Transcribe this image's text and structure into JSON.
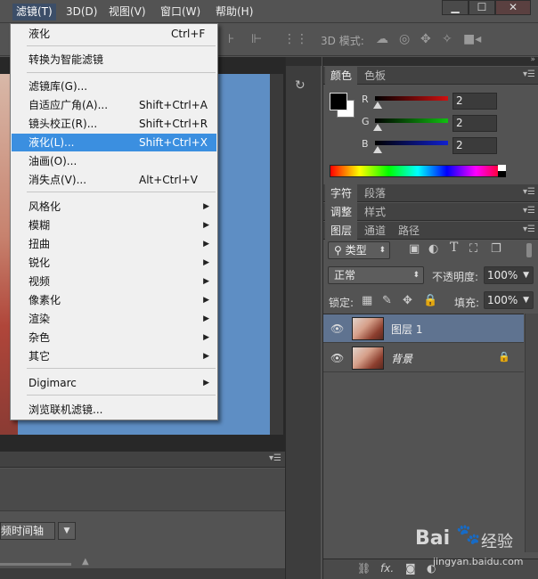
{
  "menubar": {
    "items": [
      {
        "label": "滤镜(T)"
      },
      {
        "label": "3D(D)"
      },
      {
        "label": "视图(V)"
      },
      {
        "label": "窗口(W)"
      },
      {
        "label": "帮助(H)"
      }
    ],
    "window_controls": [
      "▁",
      "☐",
      "✕"
    ]
  },
  "options_bar": {
    "mode_label": "3D 模式:"
  },
  "filter_menu": {
    "items": [
      {
        "label": "液化",
        "shortcut": "Ctrl+F"
      },
      {
        "label": "转换为智能滤镜",
        "shortcut": ""
      },
      {
        "label": "滤镜库(G)...",
        "shortcut": ""
      },
      {
        "label": "自适应广角(A)...",
        "shortcut": "Shift+Ctrl+A"
      },
      {
        "label": "镜头校正(R)...",
        "shortcut": "Shift+Ctrl+R"
      },
      {
        "label": "液化(L)...",
        "shortcut": "Shift+Ctrl+X"
      },
      {
        "label": "油画(O)...",
        "shortcut": ""
      },
      {
        "label": "消失点(V)...",
        "shortcut": "Alt+Ctrl+V"
      },
      {
        "label": "风格化",
        "shortcut": ""
      },
      {
        "label": "模糊",
        "shortcut": ""
      },
      {
        "label": "扭曲",
        "shortcut": ""
      },
      {
        "label": "锐化",
        "shortcut": ""
      },
      {
        "label": "视频",
        "shortcut": ""
      },
      {
        "label": "像素化",
        "shortcut": ""
      },
      {
        "label": "渲染",
        "shortcut": ""
      },
      {
        "label": "杂色",
        "shortcut": ""
      },
      {
        "label": "其它",
        "shortcut": ""
      },
      {
        "label": "Digimarc",
        "shortcut": ""
      },
      {
        "label": "浏览联机滤镜...",
        "shortcut": ""
      }
    ],
    "highlighted": "液化(L)..."
  },
  "timeline": {
    "button_label": "频时间轴"
  },
  "color_panel": {
    "tabs": [
      "颜色",
      "色板"
    ],
    "channels": [
      {
        "name": "R",
        "value": "2",
        "color": "#d01010"
      },
      {
        "name": "G",
        "value": "2",
        "color": "#10c010"
      },
      {
        "name": "B",
        "value": "2",
        "color": "#1020d0"
      }
    ],
    "foreground": "#000000",
    "background": "#ffffff"
  },
  "char_panel": {
    "tabs": [
      "字符",
      "段落"
    ]
  },
  "adjust_panel": {
    "tabs": [
      "调整",
      "样式"
    ]
  },
  "layers_panel": {
    "tabs": [
      "图层",
      "通道",
      "路径"
    ],
    "filter_kind": "类型",
    "blend_mode": "正常",
    "opacity_label": "不透明度:",
    "opacity_value": "100%",
    "lock_label": "锁定:",
    "fill_label": "填充:",
    "fill_value": "100%",
    "layers": [
      {
        "name": "图层 1",
        "selected": true
      },
      {
        "name": "背景",
        "selected": false,
        "locked": true
      }
    ],
    "footer_fx": "fx."
  },
  "watermark": {
    "brand": "Bai",
    "brand_suffix": "经验",
    "url": "jingyan.baidu.com"
  }
}
